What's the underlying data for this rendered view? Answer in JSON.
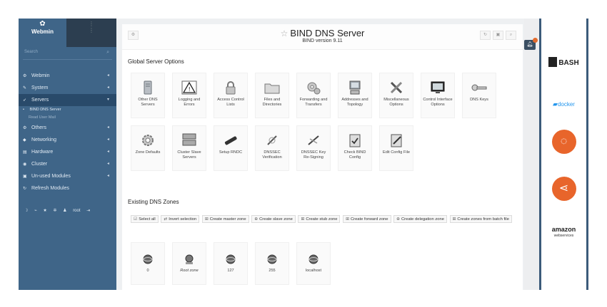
{
  "sidebar": {
    "brand": "Webmin",
    "brand_icon": "webmin-logo-icon",
    "search_placeholder": "Search",
    "items": [
      {
        "label": "Webmin",
        "icon": "gear-icon"
      },
      {
        "label": "System",
        "icon": "wrench-icon"
      },
      {
        "label": "Servers",
        "icon": "rocket-icon"
      },
      {
        "label": "Others",
        "icon": "gear-icon"
      },
      {
        "label": "Networking",
        "icon": "network-icon"
      },
      {
        "label": "Hardware",
        "icon": "hardware-icon"
      },
      {
        "label": "Cluster",
        "icon": "cluster-icon"
      },
      {
        "label": "Un-used Modules",
        "icon": "puzzle-icon"
      },
      {
        "label": "Refresh Modules",
        "icon": "refresh-icon"
      }
    ],
    "sub_items": [
      {
        "label": "BIND DNS Server"
      },
      {
        "label": "Read User Mail"
      }
    ],
    "bottom_user": "root"
  },
  "header": {
    "title": "BIND DNS Server",
    "subtitle": "BIND version 9.11"
  },
  "global": {
    "heading": "Global Server Options",
    "row1": [
      {
        "label": "Other DNS Servers",
        "icon": "servers-icon"
      },
      {
        "label": "Logging and Errors",
        "icon": "warning-icon"
      },
      {
        "label": "Access Control Lists",
        "icon": "lock-icon"
      },
      {
        "label": "Files and Directories",
        "icon": "folder-icon"
      },
      {
        "label": "Forwarding and Transfers",
        "icon": "gears-icon"
      },
      {
        "label": "Addresses and Topology",
        "icon": "computer-icon"
      },
      {
        "label": "Miscellaneous Options",
        "icon": "tools-icon"
      },
      {
        "label": "Control Interface Options",
        "icon": "monitor-icon"
      },
      {
        "label": "DNS Keys",
        "icon": "key-icon"
      }
    ],
    "row2": [
      {
        "label": "Zone Defaults",
        "icon": "cog-icon"
      },
      {
        "label": "Cluster Slave Servers",
        "icon": "cluster-servers-icon"
      },
      {
        "label": "Setup RNDC",
        "icon": "remote-icon"
      },
      {
        "label": "DNSSEC Verification",
        "icon": "dnssec-verify-icon"
      },
      {
        "label": "DNSSEC Key Re-Signing",
        "icon": "dnssec-resign-icon"
      },
      {
        "label": "Check BIND Config",
        "icon": "clipboard-check-icon"
      },
      {
        "label": "Edit Config File",
        "icon": "edit-file-icon"
      }
    ]
  },
  "zones": {
    "heading": "Existing DNS Zones",
    "buttons": [
      "Select all",
      "Invert selection",
      "Create master zone",
      "Create slave zone",
      "Create stub zone",
      "Create forward zone",
      "Create delegation zone",
      "Create zones from batch file"
    ],
    "list": [
      {
        "label": "0"
      },
      {
        "label": "Root zone"
      },
      {
        "label": "127"
      },
      {
        "label": "255"
      },
      {
        "label": "localhost"
      }
    ]
  },
  "right_panel": {
    "bash": "BASH",
    "docker": "docker",
    "aws": "amazon",
    "aws_sub": "webservices"
  },
  "colors": {
    "sidebar_bg": "#3f6588",
    "active_bg": "#294a6a",
    "accent_orange": "#e8652b"
  }
}
